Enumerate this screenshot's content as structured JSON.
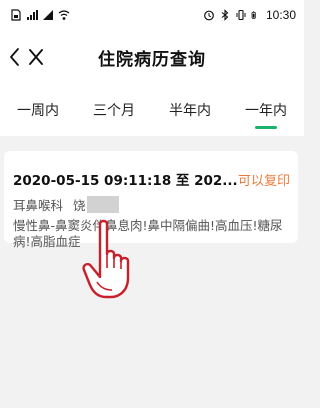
{
  "status_bar": {
    "time": "10:30"
  },
  "header": {
    "title": "住院病历查询"
  },
  "tabs": [
    {
      "label": "一周内",
      "active": false
    },
    {
      "label": "三个月",
      "active": false
    },
    {
      "label": "半年内",
      "active": false
    },
    {
      "label": "一年内",
      "active": true
    }
  ],
  "record": {
    "datetime": "2020-05-15 09:11:18 至 202...",
    "action": "可以复印",
    "department": "耳鼻喉科",
    "doctor": "饶",
    "diagnosis": "慢性鼻-鼻窦炎伴鼻息肉!鼻中隔偏曲!高血压!糖尿病!高脂血症"
  },
  "colors": {
    "accent": "#19b36b",
    "action": "#f07a3a",
    "background": "#f2f2f2"
  }
}
